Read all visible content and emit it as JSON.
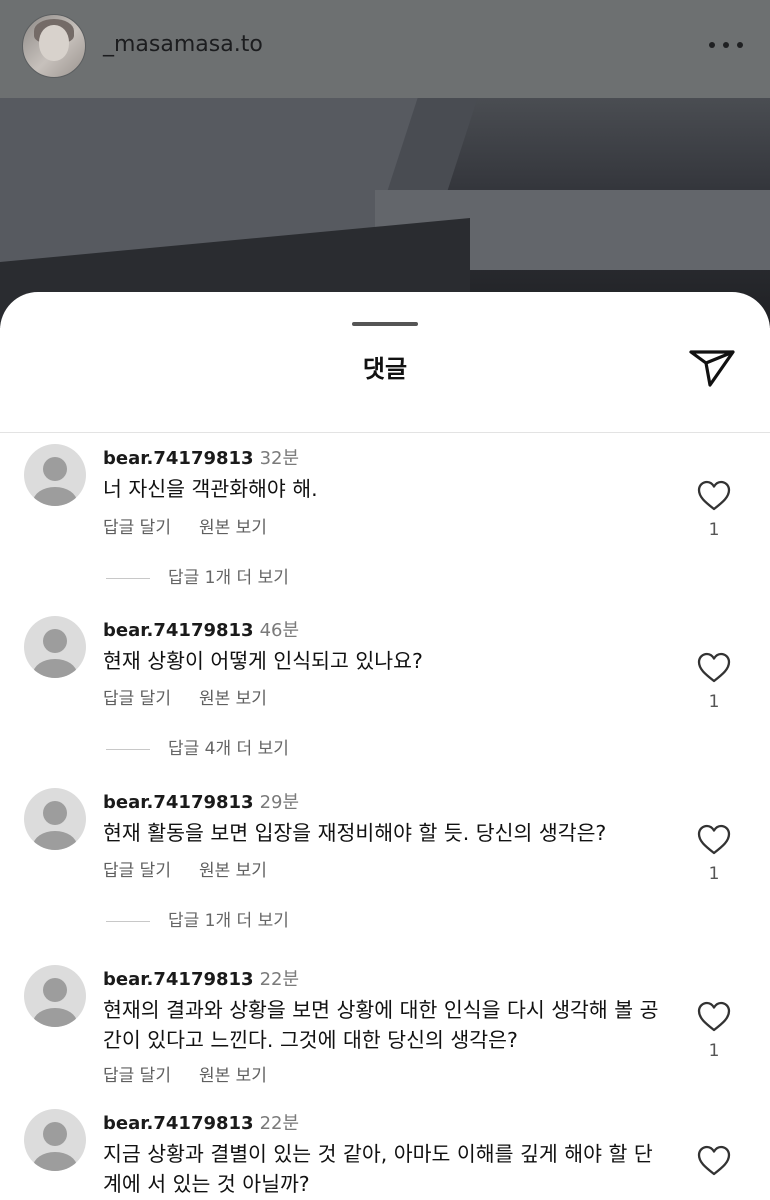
{
  "header": {
    "username": "_masamasa.to",
    "more_icon": "more-horizontal-icon"
  },
  "sheet": {
    "title": "댓글",
    "send_icon": "send-icon"
  },
  "comments": [
    {
      "user": "bear.74179813",
      "time": "32분",
      "text": "너 자신을 객관화해야 해.",
      "reply_label": "답글 달기",
      "original_label": "원본 보기",
      "likes": "1",
      "more_replies": "답글 1개 더 보기"
    },
    {
      "user": "bear.74179813",
      "time": "46분",
      "text": "현재 상황이 어떻게 인식되고 있나요?",
      "reply_label": "답글 달기",
      "original_label": "원본 보기",
      "likes": "1",
      "more_replies": "답글 4개 더 보기"
    },
    {
      "user": "bear.74179813",
      "time": "29분",
      "text": "현재 활동을 보면 입장을 재정비해야 할 듯. 당신의 생각은?",
      "reply_label": "답글 달기",
      "original_label": "원본 보기",
      "likes": "1",
      "more_replies": "답글 1개 더 보기"
    },
    {
      "user": "bear.74179813",
      "time": "22분",
      "text": "현재의 결과와 상황을 보면 상황에 대한 인식을 다시 생각해 볼 공간이 있다고 느낀다. 그것에 대한 당신의 생각은?",
      "reply_label": "답글 달기",
      "original_label": "원본 보기",
      "likes": "1"
    },
    {
      "user": "bear.74179813",
      "time": "22분",
      "text": "지금 상황과 결별이 있는 것 같아, 아마도 이해를 깊게 해야 할 단계에 서 있는 것 아닐까?"
    }
  ]
}
